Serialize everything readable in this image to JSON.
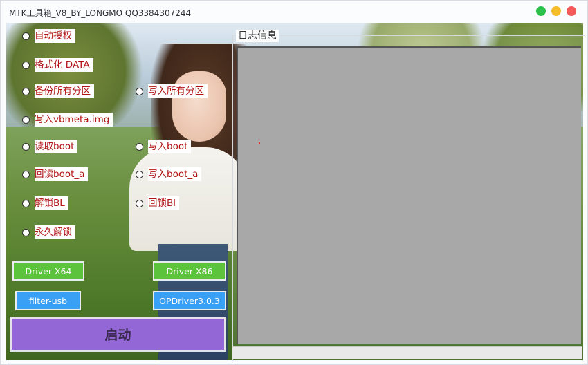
{
  "window": {
    "title": "MTK工具箱_V8_BY_LONGMO QQ3384307244",
    "controls": [
      "green-maximize",
      "yellow-minimize",
      "red-close"
    ]
  },
  "options": {
    "auto_auth": "自动授权",
    "format_data": "格式化 DATA",
    "backup_all": "备份所有分区",
    "write_all": "写入所有分区",
    "write_vbmeta": "写入vbmeta.img",
    "read_boot": "读取boot",
    "write_boot": "写入boot",
    "readback_boot_a": "回读boot_a",
    "write_boot_a": "写入boot_a",
    "unlock_bl": "解锁BL",
    "relock_bl": "回锁Bl",
    "perm_unlock": "永久解锁"
  },
  "buttons": {
    "driver_x64": "Driver X64",
    "driver_x86": "Driver X86",
    "filter_usb": "filter-usb",
    "opdriver": "OPDriver3.0.3",
    "start": "启动"
  },
  "log": {
    "title": "日志信息"
  },
  "colors": {
    "option_text": "#b11414",
    "driver_button": "#5cc33c",
    "utility_button": "#3aa0f5",
    "start_button": "#9467d6",
    "log_background": "#a8a8a8"
  }
}
